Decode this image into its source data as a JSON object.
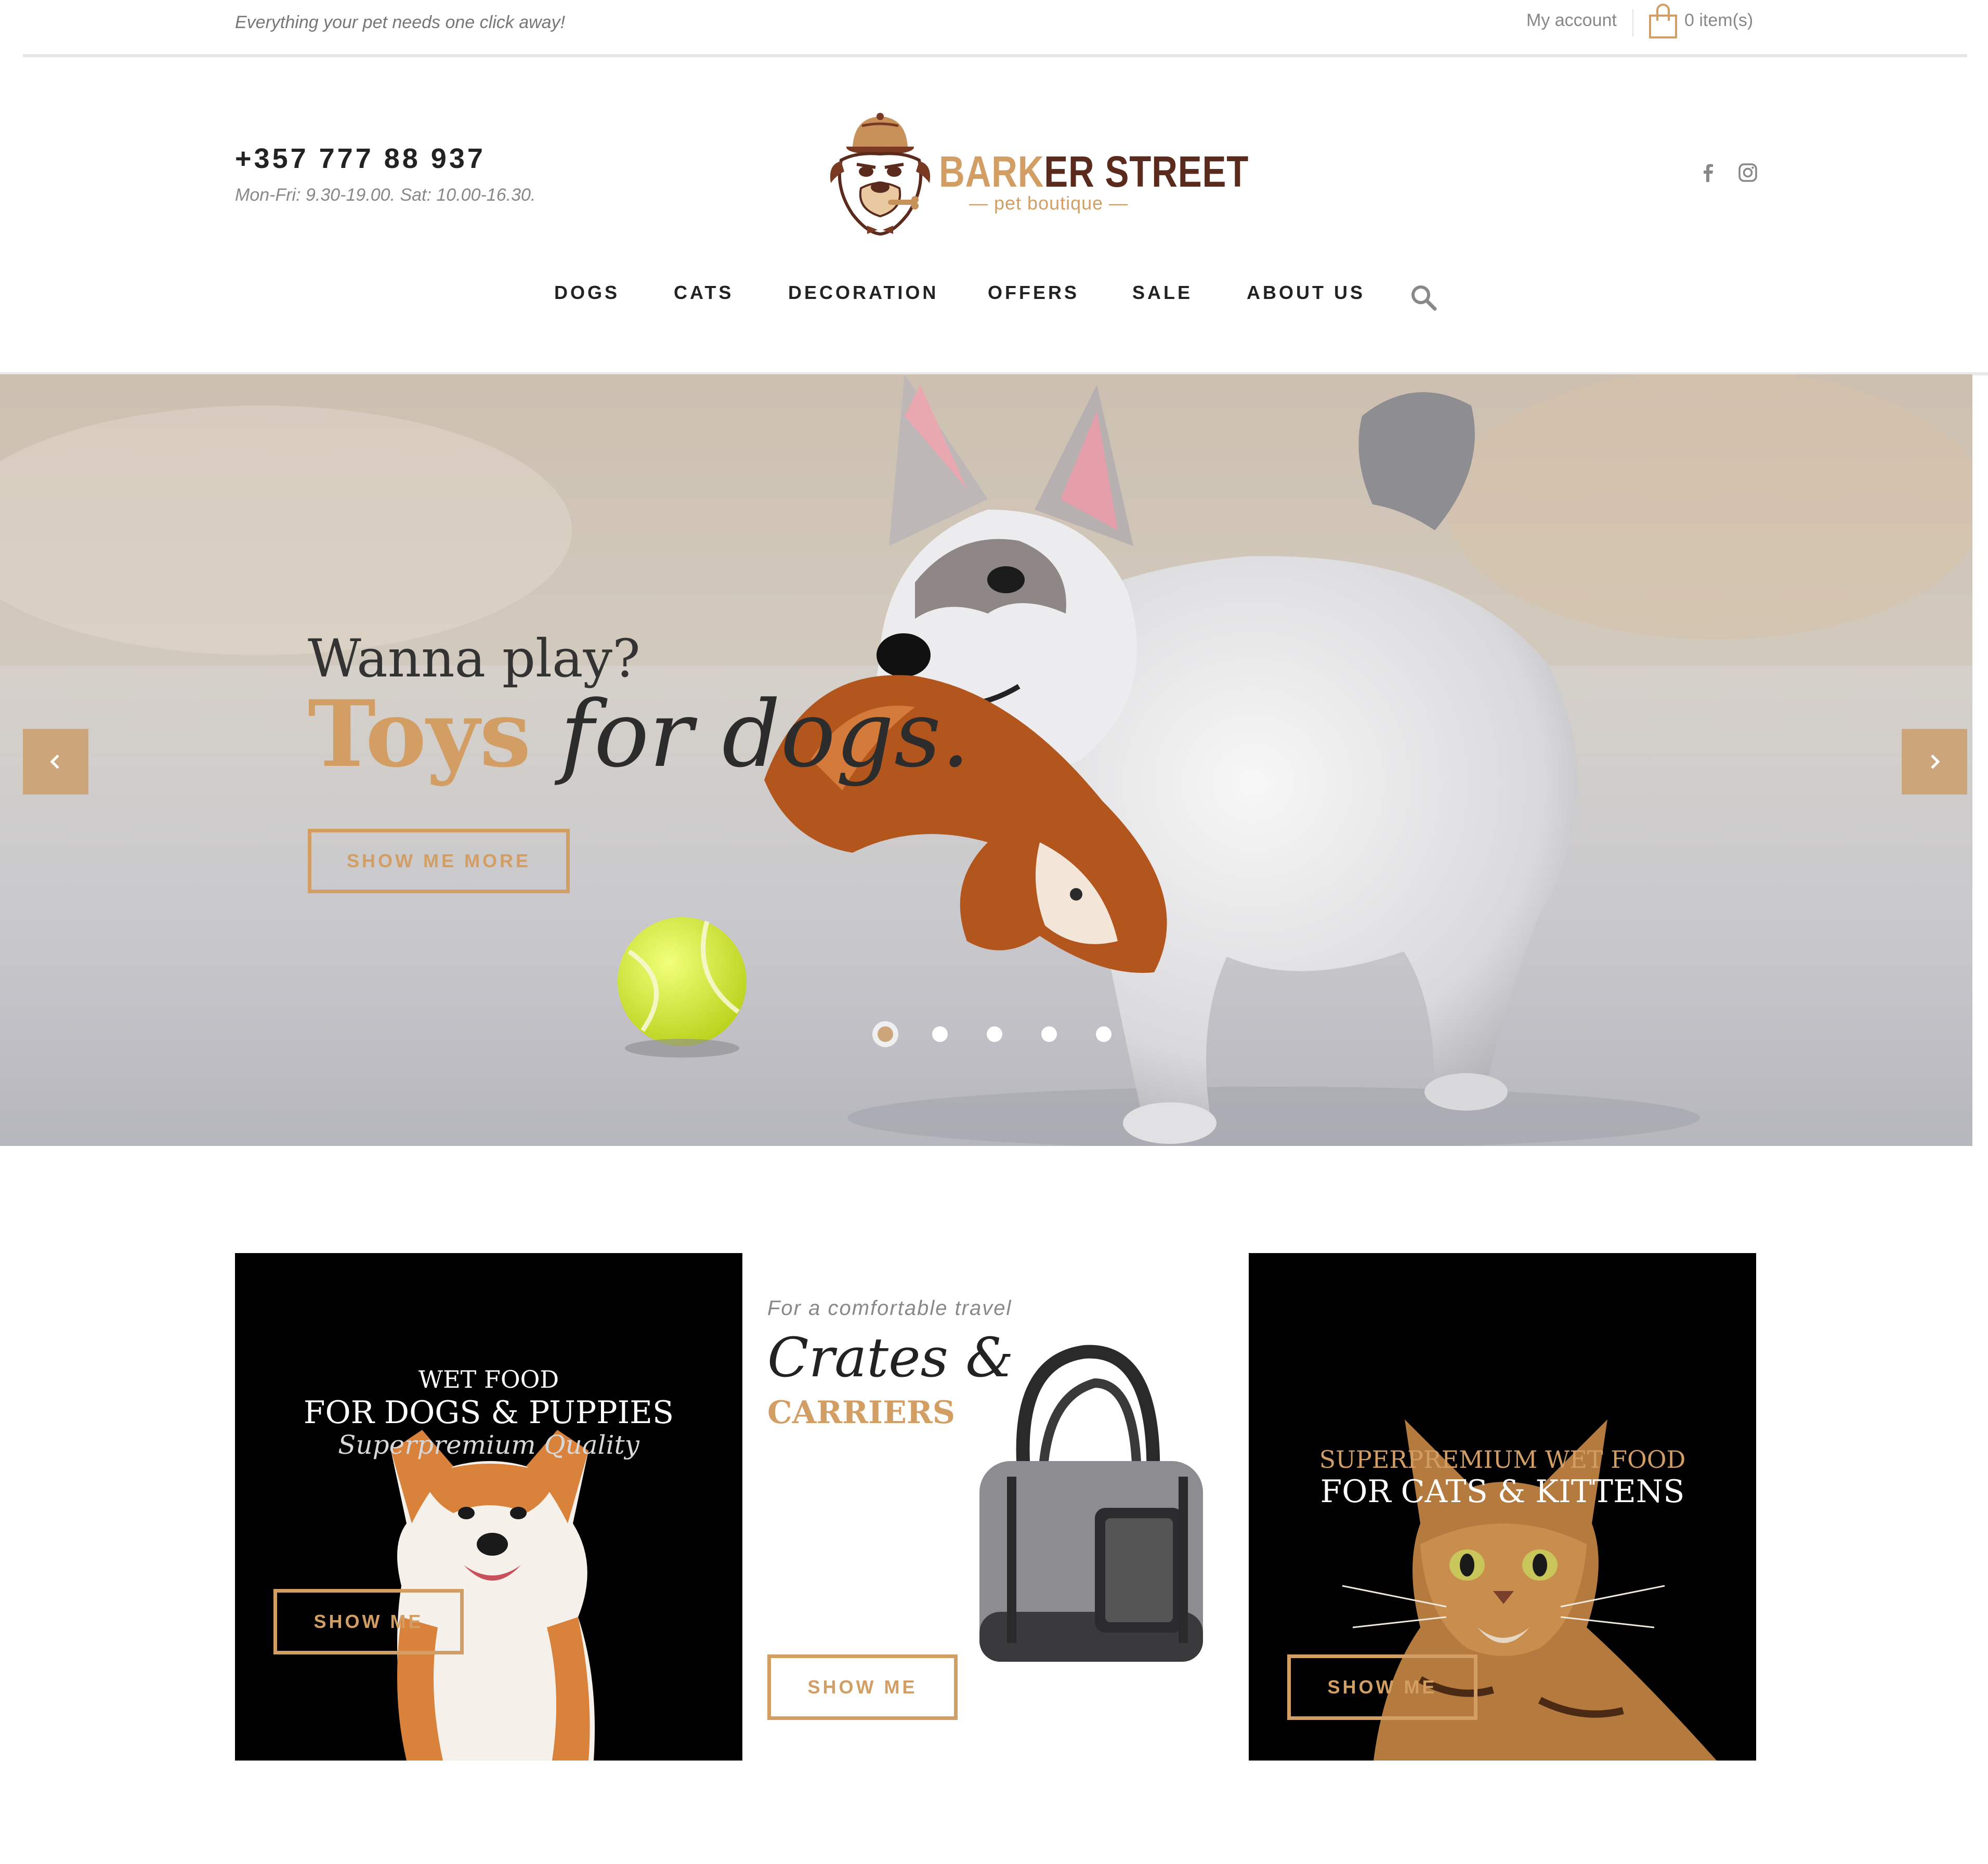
{
  "topbar": {
    "tagline": "Everything your pet needs one click away!",
    "my_account": "My account",
    "cart_count": "0 item(s)"
  },
  "header": {
    "phone": "+357 777 88 937",
    "hours": "Mon-Fri: 9.30-19.00. Sat: 10.00-16.30.",
    "brand_part1": "BARK",
    "brand_part2": "ER STREET",
    "brand_sub": "— pet boutique —"
  },
  "nav": {
    "items": [
      "DOGS",
      "CATS",
      "DECORATION",
      "OFFERS",
      "SALE",
      "ABOUT US"
    ]
  },
  "hero": {
    "subtitle": "Wanna play?",
    "title_accent": "Toys",
    "title_rest": "for dogs.",
    "cta": "SHOW ME MORE",
    "slide_count": 5,
    "active_slide": 1
  },
  "cards": {
    "dogs": {
      "line1": "WET FOOD",
      "line2": "FOR DOGS & PUPPIES",
      "line3": "Superpremium Quality",
      "button": "SHOW ME"
    },
    "crates": {
      "kicker": "For a comfortable travel",
      "title": "Crates &",
      "subtitle": "CARRIERS",
      "button": "SHOW ME"
    },
    "cats": {
      "line1": "SUPERPREMIUM WET FOOD",
      "line2": "FOR CATS & KITTENS",
      "button": "SHOW ME"
    }
  },
  "colors": {
    "accent": "#d29e64",
    "brand_dark": "#5a2a1c",
    "arrow_bg": "#cda57a"
  }
}
